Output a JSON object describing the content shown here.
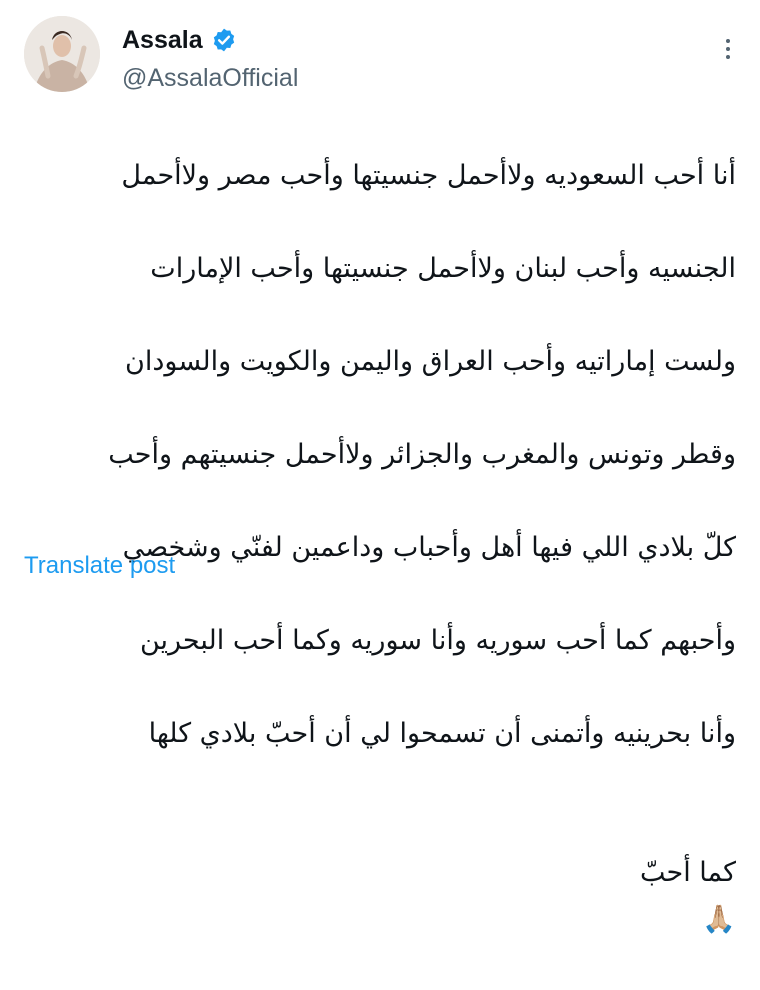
{
  "author": {
    "display_name": "Assala",
    "handle": "@AssalaOfficial",
    "verified_color": "#1d9bf0",
    "avatar_icon": "avatar-photo"
  },
  "tweet": {
    "lines": [
      "أنا أحب السعوديه ولاأحمل جنسيتها وأحب مصر ولاأحمل",
      "الجنسيه وأحب لبنان ولاأحمل جنسيتها وأحب الإمارات",
      "ولست إماراتيه وأحب العراق واليمن والكويت والسودان",
      "وقطر وتونس والمغرب والجزائر ولاأحمل جنسيتهم وأحب",
      "كلّ بلادي اللي فيها أهل وأحباب وداعمين لفنّي وشخصي",
      "وأحبهم كما أحب سوريه وأنا سوريه وكما أحب البحرين",
      "وأنا بحرينيه وأتمنى أن تسمحوا لي أن أحبّ بلادي كلها",
      "كما أحبّ"
    ],
    "emoji": "🙏🏼"
  },
  "actions": {
    "translate_label": "Translate post",
    "more_icon": "more-options-icon"
  },
  "colors": {
    "text": "#0f1419",
    "secondary": "#536471",
    "link": "#1d9bf0"
  }
}
